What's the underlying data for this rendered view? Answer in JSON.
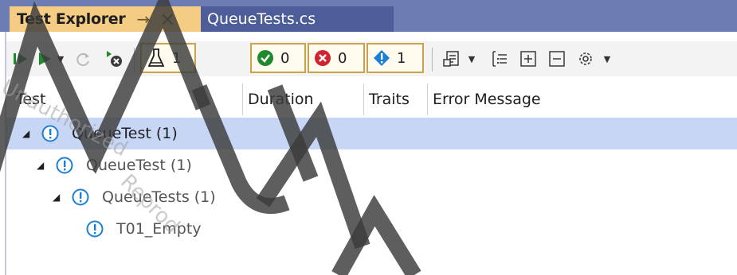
{
  "tabs": {
    "active_title": "Test Explorer",
    "pin_glyph": "→",
    "close_glyph": "×",
    "document_title": "QueueTests.cs"
  },
  "toolbar": {
    "counters": {
      "total": "1",
      "passed": "0",
      "failed": "0",
      "not_run": "1"
    },
    "icons": [
      "run-all-icon",
      "run-icon",
      "repeat-last-run-icon",
      "cancel-icon",
      "flask-icon",
      "passed-icon",
      "failed-icon",
      "not-run-icon",
      "playlist-icon",
      "group-by-icon",
      "expand-all-icon",
      "collapse-all-icon",
      "settings-icon"
    ]
  },
  "columns": {
    "test": "Test",
    "duration": "Duration",
    "traits": "Traits",
    "error_message": "Error Message"
  },
  "tree": [
    {
      "label": "QueueTest (1)",
      "level": 0,
      "selected": true,
      "expanded": true
    },
    {
      "label": "QueueTest (1)",
      "level": 1,
      "selected": false,
      "expanded": true
    },
    {
      "label": "QueueTests (1)",
      "level": 2,
      "selected": false,
      "expanded": true
    },
    {
      "label": "T01_Empty",
      "level": 3,
      "selected": false,
      "expanded": false
    }
  ],
  "colors": {
    "accent_tab": "#f5cc84",
    "tabstrip": "#6b7db2",
    "selection": "#c7d6f4",
    "not_run_blue": "#1c7fd6",
    "passed_green": "#1f8a2c",
    "failed_red": "#d1242f"
  },
  "watermark": {
    "letters": "MUAT",
    "faint_text": "Unauthorized Reproduction"
  }
}
